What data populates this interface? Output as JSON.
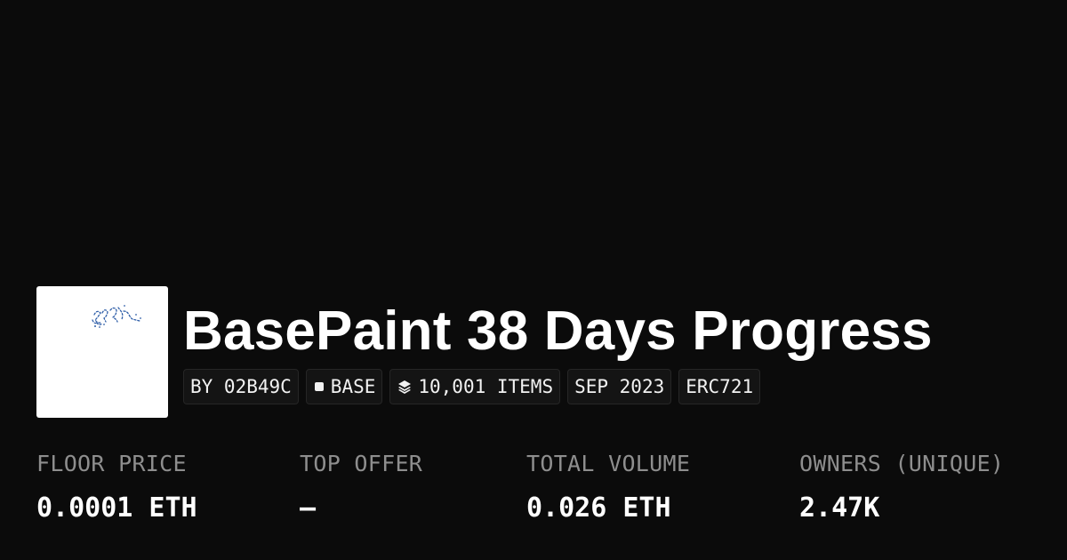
{
  "collection": {
    "title": "BasePaint 38 Days Progress",
    "thumbnail_background": "#ffffff"
  },
  "tags": [
    {
      "label": "BY 02B49C",
      "icon": null
    },
    {
      "label": "BASE",
      "icon": "square-chain-icon"
    },
    {
      "label": "10,001 ITEMS",
      "icon": "layers-icon"
    },
    {
      "label": "SEP 2023",
      "icon": null
    },
    {
      "label": "ERC721",
      "icon": null
    }
  ],
  "stats": [
    {
      "label": "FLOOR PRICE",
      "value": "0.0001 ETH"
    },
    {
      "label": "TOP OFFER",
      "value": "—"
    },
    {
      "label": "TOTAL VOLUME",
      "value": "0.026 ETH"
    },
    {
      "label": "OWNERS (UNIQUE)",
      "value": "2.47K"
    }
  ],
  "colors": {
    "background": "#0b0b0b",
    "text": "#ffffff",
    "label": "#8e8e8e",
    "tag_background": "#141414",
    "tag_border": "#262626",
    "sketch": "#2f5ea8"
  }
}
